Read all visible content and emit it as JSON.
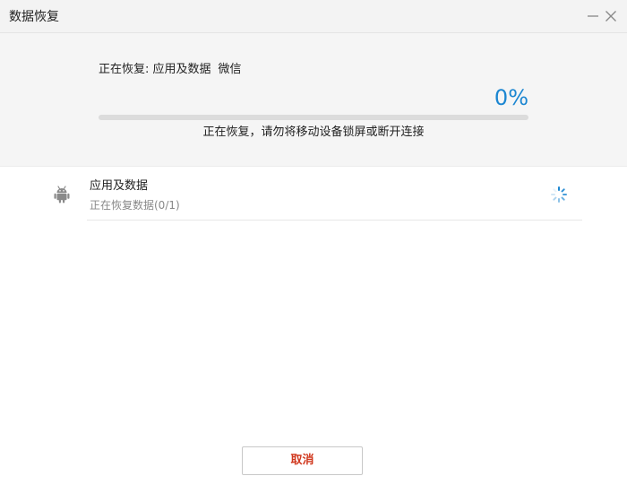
{
  "window": {
    "title": "数据恢复"
  },
  "progress": {
    "status_prefix": "正在恢复: 应用及数据",
    "status_app": "微信",
    "percent_text": "0%",
    "value": 0,
    "warning": "正在恢复，请勿将移动设备锁屏或断开连接"
  },
  "items": [
    {
      "icon": "android-icon",
      "title": "应用及数据",
      "subtitle": "正在恢复数据(0/1)",
      "status_icon": "loading-spinner-icon"
    }
  ],
  "footer": {
    "cancel_label": "取消"
  },
  "colors": {
    "accent": "#1b86d1",
    "cancel_text": "#d0381e",
    "header_bg": "#f5f5f5"
  }
}
